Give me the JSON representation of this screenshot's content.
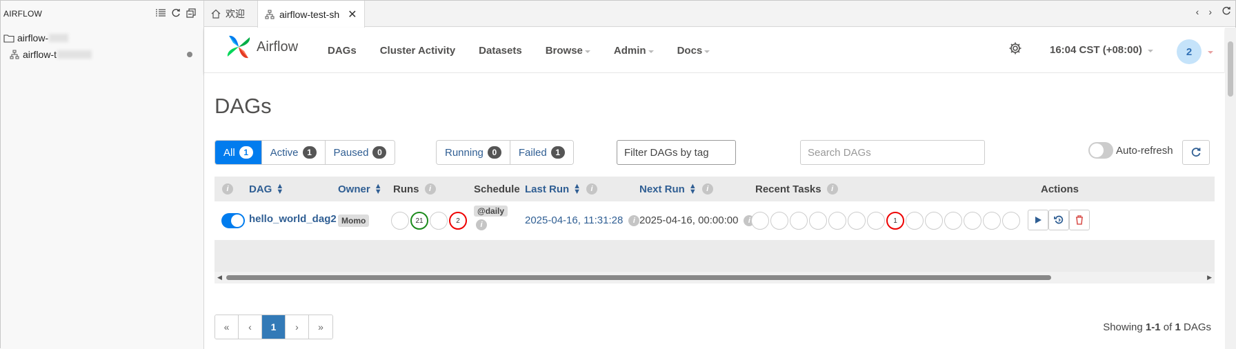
{
  "sidebar": {
    "title": "AIRFLOW",
    "tree": [
      {
        "label": "airflow-"
      },
      {
        "label": "airflow-t"
      }
    ]
  },
  "tabs": [
    {
      "label": "欢迎"
    },
    {
      "label": "airflow-test-sh",
      "close": "✕"
    }
  ],
  "tab_nav": {
    "back": "‹",
    "forward": "›"
  },
  "navbar": {
    "brand": "Airflow",
    "menu": [
      "DAGs",
      "Cluster Activity",
      "Datasets",
      "Browse",
      "Admin",
      "Docs"
    ],
    "time": "16:04 CST (+08:00)",
    "avatar": "2"
  },
  "page": {
    "title": "DAGs",
    "status_filters": [
      {
        "label": "All",
        "count": "1"
      },
      {
        "label": "Active",
        "count": "1"
      },
      {
        "label": "Paused",
        "count": "0"
      }
    ],
    "run_filters": [
      {
        "label": "Running",
        "count": "0"
      },
      {
        "label": "Failed",
        "count": "1"
      }
    ],
    "tag_filter_placeholder": "Filter DAGs by tag",
    "search_placeholder": "Search DAGs",
    "auto_refresh": "Auto-refresh"
  },
  "table": {
    "headers": {
      "dag": "DAG",
      "owner": "Owner",
      "runs": "Runs",
      "schedule": "Schedule",
      "last_run": "Last Run",
      "next_run": "Next Run",
      "recent_tasks": "Recent Tasks",
      "actions": "Actions"
    },
    "rows": [
      {
        "dag_id": "hello_world_dag2",
        "owner": "Momo",
        "runs": [
          "",
          "21",
          "",
          "2"
        ],
        "schedule": "@daily",
        "last_run": "2025-04-16, 11:31:28",
        "next_run": "2025-04-16, 00:00:00",
        "recent_tasks": [
          "",
          "",
          "",
          "",
          "",
          "",
          "",
          "1",
          "",
          "",
          "",
          "",
          "",
          ""
        ]
      }
    ]
  },
  "pagination": {
    "first": "«",
    "prev": "‹",
    "current": "1",
    "next": "›",
    "last": "»"
  },
  "showing": {
    "prefix": "Showing ",
    "range": "1-1",
    "of": " of ",
    "total": "1",
    "suffix": " DAGs"
  },
  "colors": {
    "primary": "#017cee",
    "link": "#2f5e93",
    "success": "#1b8a1b",
    "failed": "#e00000"
  }
}
